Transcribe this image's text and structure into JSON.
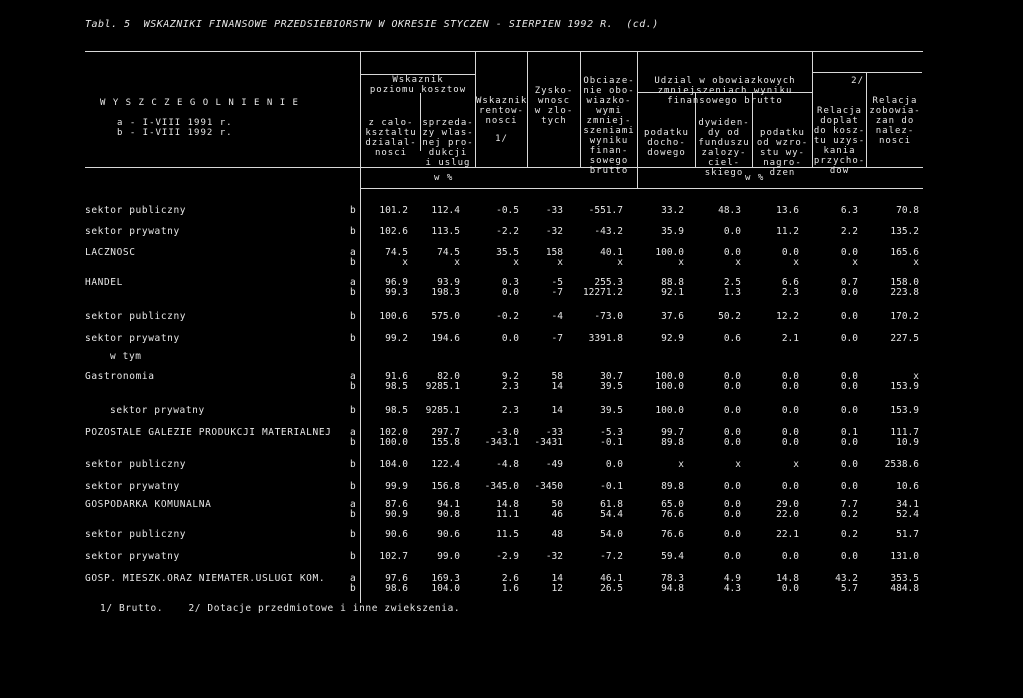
{
  "title": "Tabl. 5  WSKAZNIKI FINANSOWE PRZEDSIEBIORSTW W OKRESIE STYCZEN - SIERPIEN 1992 R.  (cd.)",
  "header": {
    "stub": [
      "W Y S Z C Z E G O L N I E N I E",
      "a - I-VIII 1991 r.",
      "b - I-VIII 1992 r."
    ],
    "wskaznik_poziomu": [
      "Wskaznik",
      "poziomu kosztow"
    ],
    "z_calo": [
      "z calo-",
      "ksztaltu",
      "dzialal-",
      "nosci"
    ],
    "sprzedazy": [
      "sprzeda-",
      "zy wlas-",
      "nej pro-",
      "dukcji",
      "i uslug"
    ],
    "rentownosci": [
      "Wskaznik",
      "rentow-",
      "nosci",
      "1/"
    ],
    "zysko": [
      "Zysko-",
      "wnosc",
      "w zlo-",
      "tych"
    ],
    "obciazenie": [
      "Obciaze-",
      "nie obo-",
      "wiazko-",
      "wymi",
      "zmniej-",
      "szeniami",
      "wyniku",
      "finan-",
      "sowego",
      "brutto"
    ],
    "udzial": [
      "Udzial w obowiazkowych",
      "zmniejszeniach wyniku",
      "finansowego brutto"
    ],
    "podatku_doch": [
      "podatku",
      "docho-",
      "dowego"
    ],
    "dywidendy": [
      "dywiden-",
      "dy od",
      "funduszu",
      "zalozy-",
      "ciel-",
      "skiego"
    ],
    "podatku_wzro": [
      "podatku",
      "od wzro-",
      "stu wy-",
      "nagro-",
      "dzen"
    ],
    "relacja_kosz": [
      "2/",
      "Relacja",
      "doplat",
      "do kosz-",
      "tu uzys-",
      "kania",
      "przycho-",
      "dow"
    ],
    "relacja_zob": [
      "Relacja",
      "zobowia-",
      "zan do",
      "nalez-",
      "nosci"
    ],
    "unit_left": "w %",
    "unit_right": "w %"
  },
  "rows": [
    {
      "label": "sektor publiczny",
      "lines": [
        [
          "b",
          "101.2",
          "112.4",
          "-0.5",
          "-33",
          "-551.7",
          "33.2",
          "48.3",
          "13.6",
          "6.3",
          "70.8"
        ]
      ]
    },
    {
      "label": "sektor prywatny",
      "lines": [
        [
          "b",
          "102.6",
          "113.5",
          "-2.2",
          "-32",
          "-43.2",
          "35.9",
          "0.0",
          "11.2",
          "2.2",
          "135.2"
        ]
      ]
    },
    {
      "label": "LACZNOSC",
      "lines": [
        [
          "a",
          "74.5",
          "74.5",
          "35.5",
          "158",
          "40.1",
          "100.0",
          "0.0",
          "0.0",
          "0.0",
          "165.6"
        ],
        [
          "b",
          "x",
          "x",
          "x",
          "x",
          "x",
          "x",
          "x",
          "x",
          "x",
          "x"
        ]
      ]
    },
    {
      "label": "HANDEL",
      "lines": [
        [
          "a",
          "96.9",
          "93.9",
          "0.3",
          "-5",
          "255.3",
          "88.8",
          "2.5",
          "6.6",
          "0.7",
          "158.0"
        ],
        [
          "b",
          "99.3",
          "198.3",
          "0.0",
          "-7",
          "12271.2",
          "92.1",
          "1.3",
          "2.3",
          "0.0",
          "223.8"
        ]
      ]
    },
    {
      "label": "sektor publiczny",
      "lines": [
        [
          "b",
          "100.6",
          "575.0",
          "-0.2",
          "-4",
          "-73.0",
          "37.6",
          "50.2",
          "12.2",
          "0.0",
          "170.2"
        ]
      ]
    },
    {
      "label": "sektor prywatny",
      "lines": [
        [
          "b",
          "99.2",
          "194.6",
          "0.0",
          "-7",
          "3391.8",
          "92.9",
          "0.6",
          "2.1",
          "0.0",
          "227.5"
        ]
      ]
    },
    {
      "label": "w tym",
      "indent": true,
      "lines": []
    },
    {
      "label": "Gastronomia",
      "lines": [
        [
          "a",
          "91.6",
          "82.0",
          "9.2",
          "58",
          "30.7",
          "100.0",
          "0.0",
          "0.0",
          "0.0",
          "x"
        ],
        [
          "b",
          "98.5",
          "9285.1",
          "2.3",
          "14",
          "39.5",
          "100.0",
          "0.0",
          "0.0",
          "0.0",
          "153.9"
        ]
      ]
    },
    {
      "label": "sektor prywatny",
      "indent": true,
      "lines": [
        [
          "b",
          "98.5",
          "9285.1",
          "2.3",
          "14",
          "39.5",
          "100.0",
          "0.0",
          "0.0",
          "0.0",
          "153.9"
        ]
      ]
    },
    {
      "label": "POZOSTALE GALEZIE PRODUKCJI MATERIALNEJ",
      "lines": [
        [
          "a",
          "102.0",
          "297.7",
          "-3.0",
          "-33",
          "-5.3",
          "99.7",
          "0.0",
          "0.0",
          "0.1",
          "111.7"
        ],
        [
          "b",
          "100.0",
          "155.8",
          "-343.1",
          "-3431",
          "-0.1",
          "89.8",
          "0.0",
          "0.0",
          "0.0",
          "10.9"
        ]
      ]
    },
    {
      "label": "sektor publiczny",
      "lines": [
        [
          "b",
          "104.0",
          "122.4",
          "-4.8",
          "-49",
          "0.0",
          "x",
          "x",
          "x",
          "0.0",
          "2538.6"
        ]
      ]
    },
    {
      "label": "sektor prywatny",
      "lines": [
        [
          "b",
          "99.9",
          "156.8",
          "-345.0",
          "-3450",
          "-0.1",
          "89.8",
          "0.0",
          "0.0",
          "0.0",
          "10.6"
        ]
      ]
    },
    {
      "label": "GOSPODARKA KOMUNALNA",
      "lines": [
        [
          "a",
          "87.6",
          "94.1",
          "14.8",
          "50",
          "61.8",
          "65.0",
          "0.0",
          "29.0",
          "7.7",
          "34.1"
        ],
        [
          "b",
          "90.9",
          "90.8",
          "11.1",
          "46",
          "54.4",
          "76.6",
          "0.0",
          "22.0",
          "0.2",
          "52.4"
        ]
      ]
    },
    {
      "label": "sektor publiczny",
      "lines": [
        [
          "b",
          "90.6",
          "90.6",
          "11.5",
          "48",
          "54.0",
          "76.6",
          "0.0",
          "22.1",
          "0.2",
          "51.7"
        ]
      ]
    },
    {
      "label": "sektor prywatny",
      "lines": [
        [
          "b",
          "102.7",
          "99.0",
          "-2.9",
          "-32",
          "-7.2",
          "59.4",
          "0.0",
          "0.0",
          "0.0",
          "131.0"
        ]
      ]
    },
    {
      "label": "GOSP. MIESZK.ORAZ NIEMATER.USLUGI KOM.",
      "lines": [
        [
          "a",
          "97.6",
          "169.3",
          "2.6",
          "14",
          "46.1",
          "78.3",
          "4.9",
          "14.8",
          "43.2",
          "353.5"
        ],
        [
          "b",
          "98.6",
          "104.0",
          "1.6",
          "12",
          "26.5",
          "94.8",
          "4.3",
          "0.0",
          "5.7",
          "484.8"
        ]
      ]
    }
  ],
  "footnote": "1/ Brutto.    2/ Dotacje przedmiotowe i inne zwiekszenia."
}
